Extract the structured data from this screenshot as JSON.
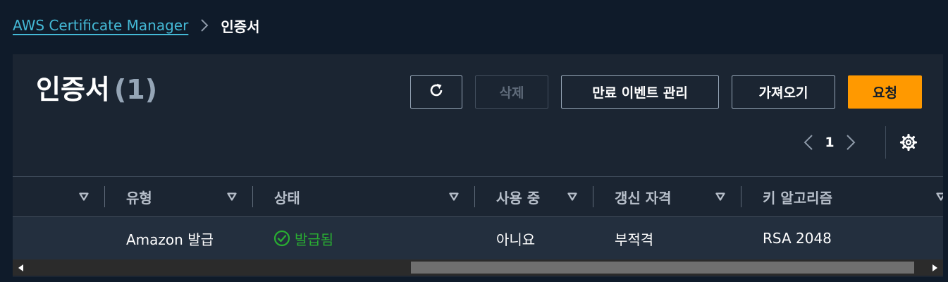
{
  "breadcrumb": {
    "parent": "AWS Certificate Manager",
    "current": "인증서"
  },
  "header": {
    "title": "인증서",
    "count": "(1)"
  },
  "toolbar": {
    "refresh_icon": "refresh-icon",
    "delete_label": "삭제",
    "expire_events_label": "만료 이벤트 관리",
    "import_label": "가져오기",
    "request_label": "요청"
  },
  "pagination": {
    "current_page": "1"
  },
  "table": {
    "columns": [
      "유형",
      "상태",
      "사용 중",
      "갱신 자격",
      "키 알고리즘"
    ],
    "rows": [
      {
        "type": "Amazon 발급",
        "status": "발급됨",
        "in_use": "아니요",
        "renewal_eligibility": "부적격",
        "key_algorithm": "RSA 2048"
      }
    ]
  },
  "colors": {
    "accent": "#ff9900",
    "link": "#44b9d6",
    "success": "#29ad32"
  }
}
